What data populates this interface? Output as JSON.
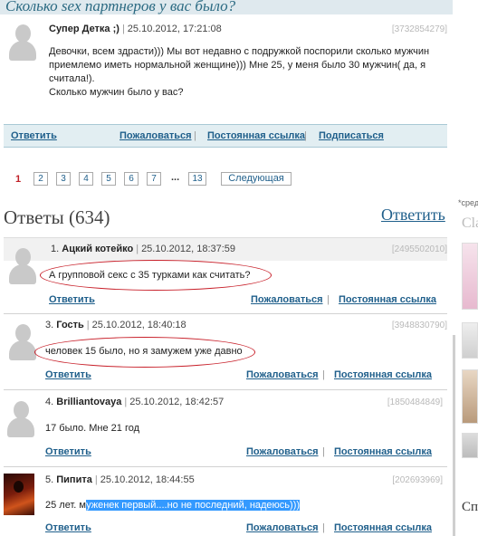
{
  "topic": {
    "title": "Сколько sex партнеров у вас было?"
  },
  "main_post": {
    "author": "Супер Детка ;)",
    "date": "25.10.2012, 17:21:08",
    "id": "[3732854279]",
    "text_lines": [
      "Девочки, всем здрасти))) Мы вот недавно с подружкой поспорили сколько мужчин",
      "приемлемо иметь нормальной женщине))) Мне 25, у меня было 30 мужчин( да, я",
      "считала!).",
      "Сколько мужчин было у вас?"
    ],
    "actions": {
      "reply": "Ответить",
      "report": "Пожаловаться",
      "permalink": "Постоянная ссылка",
      "subscribe": "Подписаться"
    }
  },
  "pagination": {
    "current": "1",
    "pages": [
      "2",
      "3",
      "4",
      "5",
      "6",
      "7"
    ],
    "ellipsis": "...",
    "last": "13",
    "next": "Следующая"
  },
  "answers": {
    "title": "Ответы (634)",
    "reply_link": "Ответить",
    "items": [
      {
        "num": "1.",
        "author": "Ацкий котейко",
        "date": "25.10.2012, 18:37:59",
        "id": "[2495502010]",
        "text": "А групповой секс с 35 турками как считать?",
        "reply": "Ответить",
        "report": "Пожаловаться",
        "permalink": "Постоянная ссылка"
      },
      {
        "num": "3.",
        "author": "Гость",
        "date": "25.10.2012, 18:40:18",
        "id": "[3948830790]",
        "text": "человек 15 было, но я замужем уже давно",
        "reply": "Ответить",
        "report": "Пожаловаться",
        "permalink": "Постоянная ссылка"
      },
      {
        "num": "4.",
        "author": "Brilliantovaya",
        "date": "25.10.2012, 18:42:57",
        "id": "[1850484849]",
        "text": "17 было. Мне 21 год",
        "reply": "Ответить",
        "report": "Пожаловаться",
        "permalink": "Постоянная ссылка"
      },
      {
        "num": "5.",
        "author": "Пипита",
        "date": "25.10.2012, 18:44:55",
        "id": "[202693969]",
        "text_plain": "25 лет. м",
        "text_selected": "уженек первый....но не последний, надеюсь)))",
        "reply": "Ответить",
        "report": "Пожаловаться",
        "permalink": "Постоянная ссылка"
      }
    ]
  },
  "sidebar": {
    "note": "*сред",
    "label1": "Cla",
    "label2": "Сп"
  },
  "colors": {
    "link": "#1f5f8b",
    "title_bg": "#dfe9ee",
    "current_page": "#c02028",
    "ellipse": "#c8202a",
    "selection": "#3399ff"
  }
}
